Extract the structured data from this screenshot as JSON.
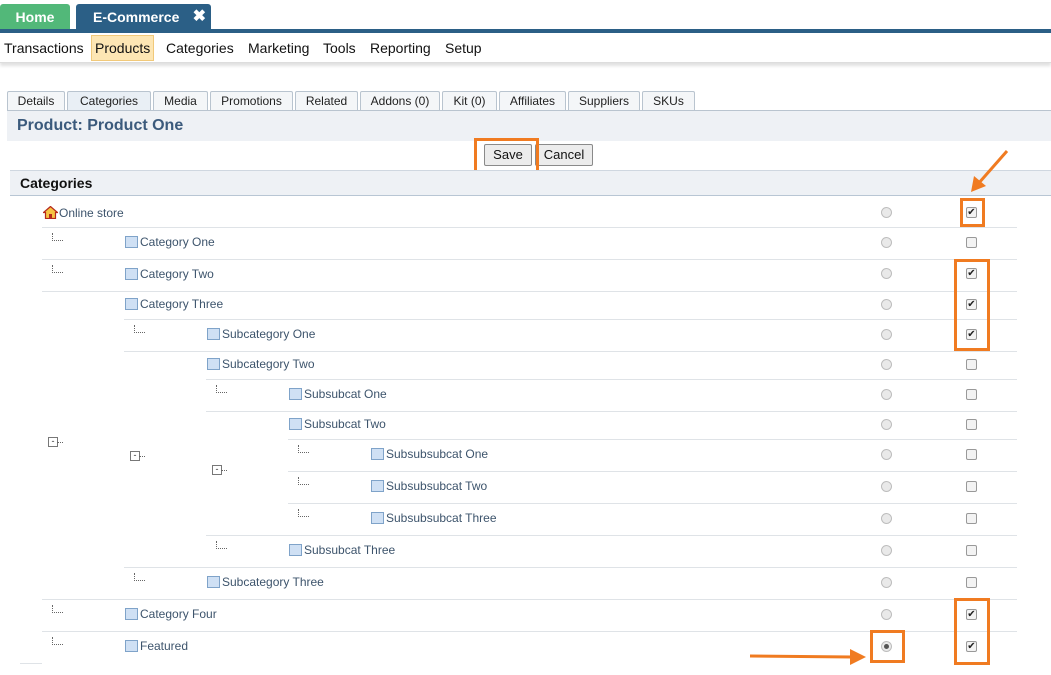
{
  "app_tabs": {
    "home": "Home",
    "ecommerce": "E-Commerce",
    "close_glyph": "✖"
  },
  "menu": {
    "items": [
      "Transactions",
      "Products",
      "Categories",
      "Marketing",
      "Tools",
      "Reporting",
      "Setup"
    ],
    "active": "Products"
  },
  "subtabs": {
    "items": [
      "Details",
      "Categories",
      "Media",
      "Promotions",
      "Related",
      "Addons (0)",
      "Kit (0)",
      "Affiliates",
      "Suppliers",
      "SKUs"
    ],
    "active": "Categories"
  },
  "product_title": "Product: Product One",
  "buttons": {
    "save": "Save",
    "cancel": "Cancel"
  },
  "categories_header": "Categories",
  "tree": [
    {
      "label": "Online store",
      "icon": "home-icon",
      "checked": true,
      "radio": false
    },
    {
      "label": "Category One",
      "icon": "folder-icon",
      "checked": false,
      "radio": false
    },
    {
      "label": "Category Two",
      "icon": "folder-icon",
      "checked": true,
      "radio": false
    },
    {
      "label": "Category Three",
      "icon": "folder-icon",
      "checked": true,
      "radio": false
    },
    {
      "label": "Subcategory One",
      "icon": "folder-icon",
      "checked": true,
      "radio": false
    },
    {
      "label": "Subcategory Two",
      "icon": "folder-icon",
      "checked": false,
      "radio": false
    },
    {
      "label": "Subsubcat One",
      "icon": "folder-icon",
      "checked": false,
      "radio": false
    },
    {
      "label": "Subsubcat Two",
      "icon": "folder-icon",
      "checked": false,
      "radio": false
    },
    {
      "label": "Subsubsubcat One",
      "icon": "folder-icon",
      "checked": false,
      "radio": false
    },
    {
      "label": "Subsubsubcat Two",
      "icon": "folder-icon",
      "checked": false,
      "radio": false
    },
    {
      "label": "Subsubsubcat Three",
      "icon": "folder-icon",
      "checked": false,
      "radio": false
    },
    {
      "label": "Subsubcat Three",
      "icon": "folder-icon",
      "checked": false,
      "radio": false
    },
    {
      "label": "Subcategory Three",
      "icon": "folder-icon",
      "checked": false,
      "radio": false
    },
    {
      "label": "Category Four",
      "icon": "folder-icon",
      "checked": true,
      "radio": false
    },
    {
      "label": "Featured",
      "icon": "folder-icon",
      "checked": true,
      "radio": true
    }
  ],
  "colors": {
    "accent_orange": "#f07b21",
    "header_blue": "#2b5f86",
    "home_green": "#52b879",
    "title_blue": "#3b5a7c"
  }
}
